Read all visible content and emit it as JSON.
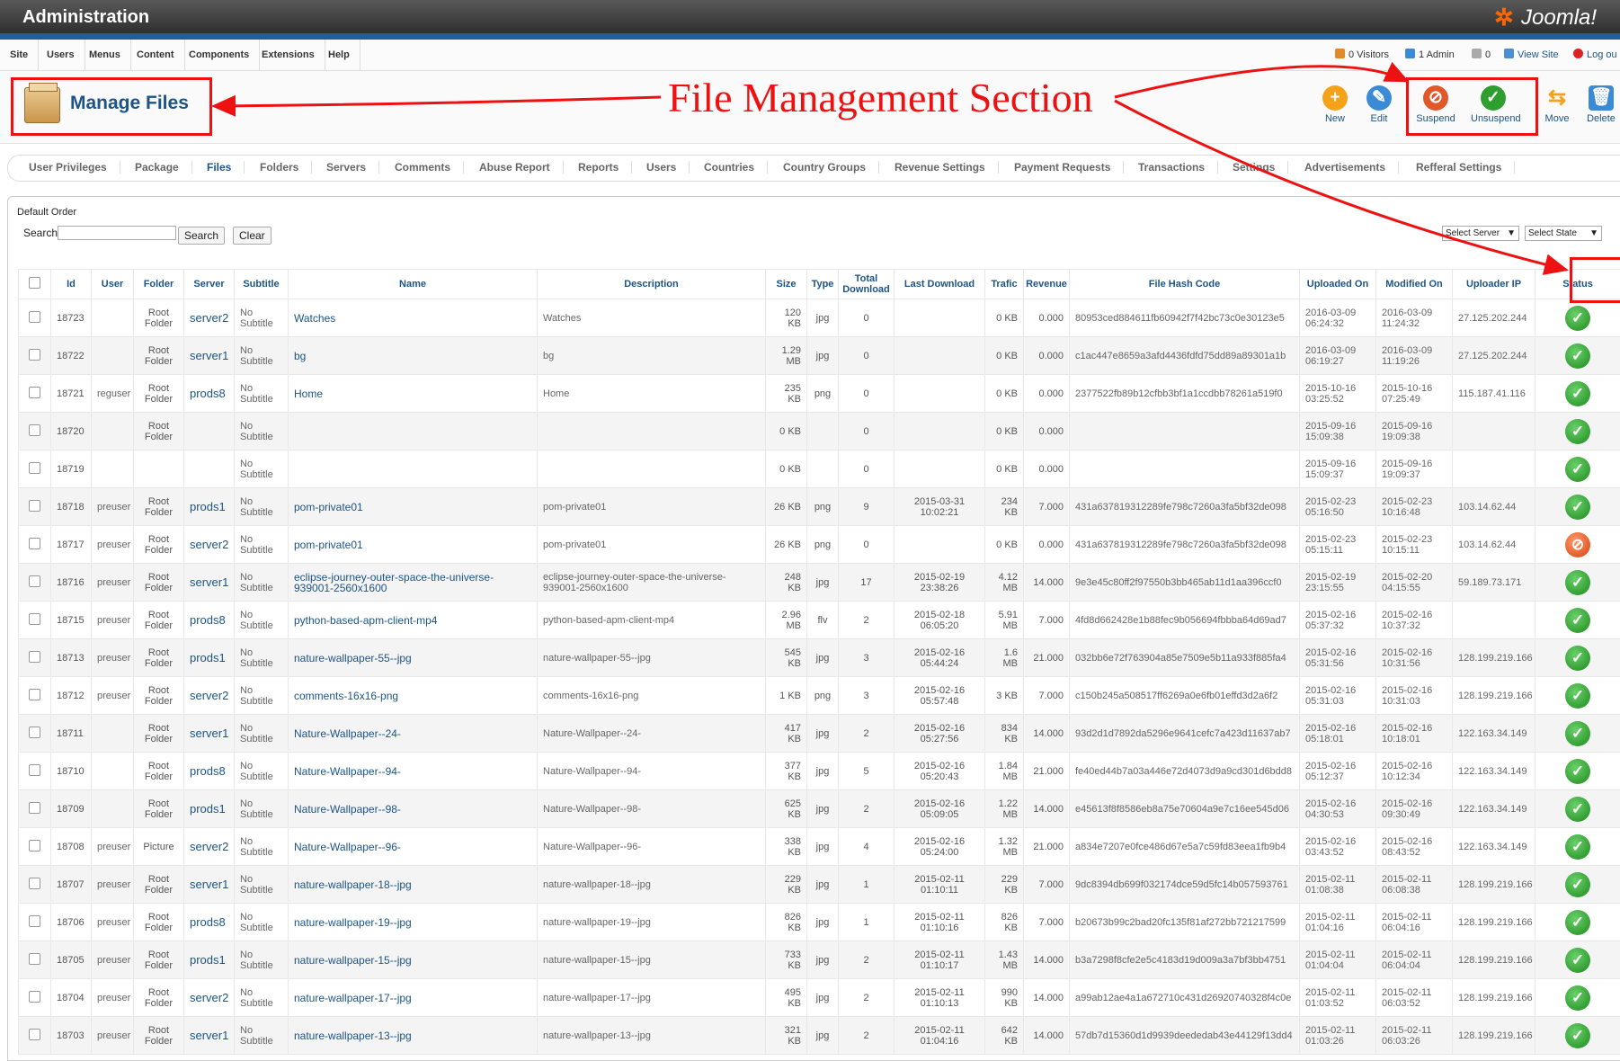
{
  "header": {
    "title": "Administration",
    "logo": "Joomla!"
  },
  "menu": {
    "items": [
      "Site",
      "Users",
      "Menus",
      "Content",
      "Components",
      "Extensions",
      "Help"
    ]
  },
  "status": {
    "visitors": "0 Visitors",
    "admins": "1 Admin",
    "messages": "0",
    "view_site": "View Site",
    "logout": "Log ou"
  },
  "page": {
    "title": "Manage Files"
  },
  "annotation": "File Management Section",
  "toolbar": {
    "buttons": [
      {
        "label": "New",
        "icon": "plus-icon",
        "color": "#f5a21b"
      },
      {
        "label": "Edit",
        "icon": "pencil-icon",
        "color": "#3a8ad6"
      },
      {
        "label": "Suspend",
        "icon": "suspend-icon",
        "color": "#e0582a"
      },
      {
        "label": "Unsuspend",
        "icon": "checkmark-icon",
        "color": "#2e9e2e"
      },
      {
        "label": "Move",
        "icon": "move-arrows-icon",
        "color": "#f5a21b"
      },
      {
        "label": "Delete",
        "icon": "trash-icon",
        "color": "#3a8ad6"
      }
    ]
  },
  "submenu": {
    "items": [
      "User Privileges",
      "Package",
      "Files",
      "Folders",
      "Servers",
      "Comments",
      "Abuse Report",
      "Reports",
      "Users",
      "Countries",
      "Country Groups",
      "Revenue Settings",
      "Payment Requests",
      "Transactions",
      "Settings",
      "Advertisements",
      "Refferal Settings"
    ],
    "active": "Files"
  },
  "filters": {
    "default_order": "Default Order",
    "search_label": "Search",
    "search_value": "",
    "search_button": "Search",
    "clear_button": "Clear",
    "select_server": "Select Server",
    "select_state": "Select State"
  },
  "table": {
    "columns": [
      "",
      "Id",
      "User",
      "Folder",
      "Server",
      "Subtitle",
      "Name",
      "Description",
      "Size",
      "Type",
      "Total Download",
      "Last Download",
      "Trafic",
      "Revenue",
      "File Hash Code",
      "Uploaded On",
      "Modified On",
      "Uploader IP",
      "Status"
    ],
    "rows": [
      [
        "18723",
        "",
        "Root Folder",
        "server2",
        "No Subtitle",
        "Watches",
        "Watches",
        "120 KB",
        "jpg",
        "0",
        "",
        "0 KB",
        "0.000",
        "80953ced884611fb60942f7f42bc73c0e30123e5",
        "2016-03-09 06:24:32",
        "2016-03-09 11:24:32",
        "27.125.202.244",
        "ok"
      ],
      [
        "18722",
        "",
        "Root Folder",
        "server1",
        "No Subtitle",
        "bg",
        "bg",
        "1.29 MB",
        "jpg",
        "0",
        "",
        "0 KB",
        "0.000",
        "c1ac447e8659a3afd4436fdfd75dd89a89301a1b",
        "2016-03-09 06:19:27",
        "2016-03-09 11:19:26",
        "27.125.202.244",
        "ok"
      ],
      [
        "18721",
        "reguser",
        "Root Folder",
        "prods8",
        "No Subtitle",
        "Home",
        "Home",
        "235 KB",
        "png",
        "0",
        "",
        "0 KB",
        "0.000",
        "2377522fb89b12cfbb3bf1a1ccdbb78261a519f0",
        "2015-10-16 03:25:52",
        "2015-10-16 07:25:49",
        "115.187.41.116",
        "ok"
      ],
      [
        "18720",
        "",
        "Root Folder",
        "",
        "No Subtitle",
        "",
        "",
        "0 KB",
        "",
        "0",
        "",
        "0 KB",
        "0.000",
        "",
        "2015-09-16 15:09:38",
        "2015-09-16 19:09:38",
        "",
        "ok"
      ],
      [
        "18719",
        "",
        "",
        "",
        "No Subtitle",
        "",
        "",
        "0 KB",
        "",
        "0",
        "",
        "0 KB",
        "0.000",
        "",
        "2015-09-16 15:09:37",
        "2015-09-16 19:09:37",
        "",
        "ok"
      ],
      [
        "18718",
        "preuser",
        "Root Folder",
        "prods1",
        "No Subtitle",
        "pom-private01",
        "pom-private01",
        "26 KB",
        "png",
        "9",
        "2015-03-31 10:02:21",
        "234 KB",
        "7.000",
        "431a637819312289fe798c7260a3fa5bf32de098",
        "2015-02-23 05:16:50",
        "2015-02-23 10:16:48",
        "103.14.62.44",
        "ok"
      ],
      [
        "18717",
        "preuser",
        "Root Folder",
        "server2",
        "No Subtitle",
        "pom-private01",
        "pom-private01",
        "26 KB",
        "png",
        "0",
        "",
        "0 KB",
        "0.000",
        "431a637819312289fe798c7260a3fa5bf32de098",
        "2015-02-23 05:15:11",
        "2015-02-23 10:15:11",
        "103.14.62.44",
        "suspended"
      ],
      [
        "18716",
        "preuser",
        "Root Folder",
        "server1",
        "No Subtitle",
        "eclipse-journey-outer-space-the-universe-939001-2560x1600",
        "eclipse-journey-outer-space-the-universe-939001-2560x1600",
        "248 KB",
        "jpg",
        "17",
        "2015-02-19 23:38:26",
        "4.12 MB",
        "14.000",
        "9e3e45c80ff2f97550b3bb465ab11d1aa396ccf0",
        "2015-02-19 23:15:55",
        "2015-02-20 04:15:55",
        "59.189.73.171",
        "ok"
      ],
      [
        "18715",
        "preuser",
        "Root Folder",
        "prods8",
        "No Subtitle",
        "python-based-apm-client-mp4",
        "python-based-apm-client-mp4",
        "2.96 MB",
        "flv",
        "2",
        "2015-02-18 06:05:20",
        "5.91 MB",
        "7.000",
        "4fd8d662428e1b88fec9b056694fbbba64d69ad7",
        "2015-02-16 05:37:32",
        "2015-02-16 10:37:32",
        "",
        "ok"
      ],
      [
        "18713",
        "preuser",
        "Root Folder",
        "prods1",
        "No Subtitle",
        "nature-wallpaper-55--jpg",
        "nature-wallpaper-55--jpg",
        "545 KB",
        "jpg",
        "3",
        "2015-02-16 05:44:24",
        "1.6 MB",
        "21.000",
        "032bb6e72f763904a85e7509e5b11a933f885fa4",
        "2015-02-16 05:31:56",
        "2015-02-16 10:31:56",
        "128.199.219.166",
        "ok"
      ],
      [
        "18712",
        "preuser",
        "Root Folder",
        "server2",
        "No Subtitle",
        "comments-16x16-png",
        "comments-16x16-png",
        "1 KB",
        "png",
        "3",
        "2015-02-16 05:57:48",
        "3 KB",
        "7.000",
        "c150b245a508517ff6269a0e6fb01effd3d2a6f2",
        "2015-02-16 05:31:03",
        "2015-02-16 10:31:03",
        "128.199.219.166",
        "ok"
      ],
      [
        "18711",
        "",
        "Root Folder",
        "server1",
        "No Subtitle",
        "Nature-Wallpaper--24-",
        "Nature-Wallpaper--24-",
        "417 KB",
        "jpg",
        "2",
        "2015-02-16 05:27:56",
        "834 KB",
        "14.000",
        "93d2d1d7892da5296e9641cefc7a423d11637ab7",
        "2015-02-16 05:18:01",
        "2015-02-16 10:18:01",
        "122.163.34.149",
        "ok"
      ],
      [
        "18710",
        "",
        "Root Folder",
        "prods8",
        "No Subtitle",
        "Nature-Wallpaper--94-",
        "Nature-Wallpaper--94-",
        "377 KB",
        "jpg",
        "5",
        "2015-02-16 05:20:43",
        "1.84 MB",
        "21.000",
        "fe40ed44b7a03a446e72d4073d9a9cd301d6bdd8",
        "2015-02-16 05:12:37",
        "2015-02-16 10:12:34",
        "122.163.34.149",
        "ok"
      ],
      [
        "18709",
        "",
        "Root Folder",
        "prods1",
        "No Subtitle",
        "Nature-Wallpaper--98-",
        "Nature-Wallpaper--98-",
        "625 KB",
        "jpg",
        "2",
        "2015-02-16 05:09:05",
        "1.22 MB",
        "14.000",
        "e45613f8f8586eb8a75e70604a9e7c16ee545d06",
        "2015-02-16 04:30:53",
        "2015-02-16 09:30:49",
        "122.163.34.149",
        "ok"
      ],
      [
        "18708",
        "preuser",
        "Picture",
        "server2",
        "No Subtitle",
        "Nature-Wallpaper--96-",
        "Nature-Wallpaper--96-",
        "338 KB",
        "jpg",
        "4",
        "2015-02-16 05:24:00",
        "1.32 MB",
        "21.000",
        "a834e7207e0fce486d67e5a7c59fd83eea1fb9b4",
        "2015-02-16 03:43:52",
        "2015-02-16 08:43:52",
        "122.163.34.149",
        "ok"
      ],
      [
        "18707",
        "preuser",
        "Root Folder",
        "server1",
        "No Subtitle",
        "nature-wallpaper-18--jpg",
        "nature-wallpaper-18--jpg",
        "229 KB",
        "jpg",
        "1",
        "2015-02-11 01:10:11",
        "229 KB",
        "7.000",
        "9dc8394db699f032174dce59d5fc14b057593761",
        "2015-02-11 01:08:38",
        "2015-02-11 06:08:38",
        "128.199.219.166",
        "ok"
      ],
      [
        "18706",
        "preuser",
        "Root Folder",
        "prods8",
        "No Subtitle",
        "nature-wallpaper-19--jpg",
        "nature-wallpaper-19--jpg",
        "826 KB",
        "jpg",
        "1",
        "2015-02-11 01:10:16",
        "826 KB",
        "7.000",
        "b20673b99c2bad20fc135f81af272bb721217599",
        "2015-02-11 01:04:16",
        "2015-02-11 06:04:16",
        "128.199.219.166",
        "ok"
      ],
      [
        "18705",
        "preuser",
        "Root Folder",
        "prods1",
        "No Subtitle",
        "nature-wallpaper-15--jpg",
        "nature-wallpaper-15--jpg",
        "733 KB",
        "jpg",
        "2",
        "2015-02-11 01:10:17",
        "1.43 MB",
        "14.000",
        "b3a7298f8cfe2e5c4183d19d009a3a7bf3bb4751",
        "2015-02-11 01:04:04",
        "2015-02-11 06:04:04",
        "128.199.219.166",
        "ok"
      ],
      [
        "18704",
        "preuser",
        "Root Folder",
        "server2",
        "No Subtitle",
        "nature-wallpaper-17--jpg",
        "nature-wallpaper-17--jpg",
        "495 KB",
        "jpg",
        "2",
        "2015-02-11 01:10:13",
        "990 KB",
        "14.000",
        "a99ab12ae4a1a672710c431d26920740328f4c0e",
        "2015-02-11 01:03:52",
        "2015-02-11 06:03:52",
        "128.199.219.166",
        "ok"
      ],
      [
        "18703",
        "preuser",
        "Root Folder",
        "server1",
        "No Subtitle",
        "nature-wallpaper-13--jpg",
        "nature-wallpaper-13--jpg",
        "321 KB",
        "jpg",
        "2",
        "2015-02-11 01:04:16",
        "642 KB",
        "14.000",
        "57db7d15360d1d9939deededab43e44129f13dd4",
        "2015-02-11 01:03:26",
        "2015-02-11 06:03:26",
        "128.199.219.166",
        "ok"
      ]
    ]
  }
}
